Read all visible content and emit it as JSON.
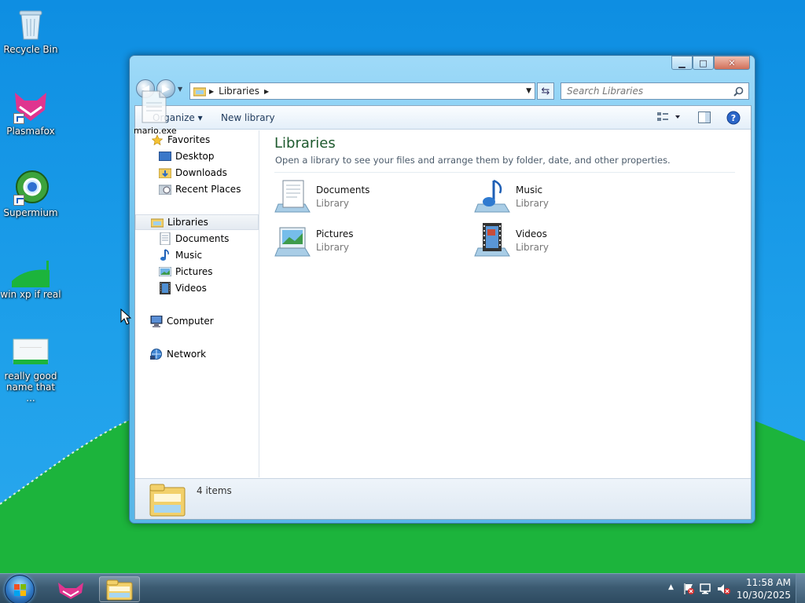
{
  "desktop": {
    "icons": [
      {
        "label": "Recycle Bin"
      },
      {
        "label": "Plasmafox"
      },
      {
        "label": "Supermium"
      },
      {
        "label": "win xp if real"
      },
      {
        "label": "really good name that ..."
      }
    ],
    "dragged_item": {
      "label": "mario.exe"
    }
  },
  "window": {
    "caption_buttons": {
      "minimize": "▁",
      "maximize": "□",
      "close": "✕"
    },
    "address": {
      "crumb": "Libraries"
    },
    "search": {
      "placeholder": "Search Libraries"
    },
    "toolbar": {
      "organize": "Organize",
      "new_library": "New library"
    },
    "nav": {
      "favorites": "Favorites",
      "desktop": "Desktop",
      "downloads": "Downloads",
      "recent": "Recent Places",
      "libraries": "Libraries",
      "documents": "Documents",
      "music": "Music",
      "pictures": "Pictures",
      "videos": "Videos",
      "computer": "Computer",
      "network": "Network"
    },
    "content": {
      "heading": "Libraries",
      "subtitle": "Open a library to see your files and arrange them by folder, date, and other properties.",
      "libraries": [
        {
          "name": "Documents",
          "type": "Library"
        },
        {
          "name": "Music",
          "type": "Library"
        },
        {
          "name": "Pictures",
          "type": "Library"
        },
        {
          "name": "Videos",
          "type": "Library"
        }
      ]
    },
    "details": {
      "count": "4 items"
    }
  },
  "taskbar": {
    "time": "11:58 AM",
    "date": "10/30/2025"
  },
  "colors": {
    "sky": "#1897e6",
    "grass": "#1cb43c",
    "heading_green": "#1e5a2e",
    "taskbar": "#3c5b72"
  }
}
